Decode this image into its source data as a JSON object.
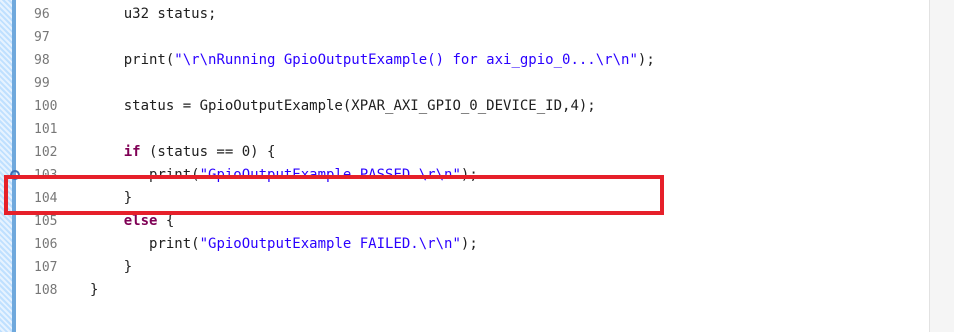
{
  "editor": {
    "line_numbers": [
      "96",
      "97",
      "98",
      "99",
      "100",
      "101",
      "102",
      "103",
      "104",
      "105",
      "106",
      "107",
      "108"
    ],
    "lines": [
      {
        "indent": "    ",
        "parts": [
          {
            "t": "u32 status;",
            "c": ""
          }
        ]
      },
      {
        "indent": "",
        "parts": []
      },
      {
        "indent": "    ",
        "parts": [
          {
            "t": "print(",
            "c": ""
          },
          {
            "t": "\"\\r\\nRunning GpioOutputExample() for axi_gpio_0...\\r\\n\"",
            "c": "str"
          },
          {
            "t": ");",
            "c": ""
          }
        ]
      },
      {
        "indent": "",
        "parts": []
      },
      {
        "indent": "    ",
        "parts": [
          {
            "t": "status = GpioOutputExample(XPAR_AXI_GPIO_0_DEVICE_ID,4);",
            "c": ""
          }
        ]
      },
      {
        "indent": "",
        "parts": []
      },
      {
        "indent": "    ",
        "parts": [
          {
            "t": "if",
            "c": "kw"
          },
          {
            "t": " (status == 0) {",
            "c": ""
          }
        ]
      },
      {
        "indent": "       ",
        "parts": [
          {
            "t": "print(",
            "c": ""
          },
          {
            "t": "\"GpioOutputExample PASSED.\\r\\n\"",
            "c": "str"
          },
          {
            "t": ");",
            "c": ""
          }
        ]
      },
      {
        "indent": "    ",
        "parts": [
          {
            "t": "}",
            "c": ""
          }
        ]
      },
      {
        "indent": "    ",
        "parts": [
          {
            "t": "else",
            "c": "kw"
          },
          {
            "t": " {",
            "c": ""
          }
        ]
      },
      {
        "indent": "       ",
        "parts": [
          {
            "t": "print(",
            "c": ""
          },
          {
            "t": "\"GpioOutputExample FAILED.\\r\\n\"",
            "c": "str"
          },
          {
            "t": ");",
            "c": ""
          }
        ]
      },
      {
        "indent": "    ",
        "parts": [
          {
            "t": "}",
            "c": ""
          }
        ]
      },
      {
        "indent": "",
        "parts": [
          {
            "t": "}",
            "c": ""
          }
        ]
      }
    ],
    "breakpoint_line": "103"
  },
  "colors": {
    "highlight_box": "#e6202a",
    "keyword": "#7f0055",
    "string": "#2a00ff",
    "line_number": "#777777"
  }
}
